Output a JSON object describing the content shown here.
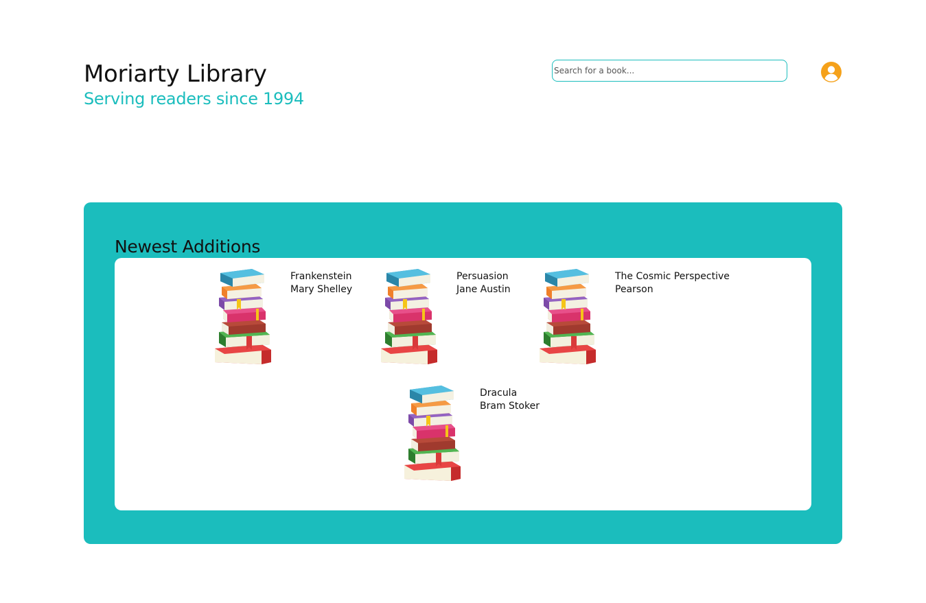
{
  "header": {
    "title": "Moriarty Library",
    "tagline": "Serving readers since 1994"
  },
  "search": {
    "placeholder": "Search for a book..."
  },
  "account": {
    "icon": "user-circle-icon",
    "color": "#f5a11a"
  },
  "colors": {
    "accent": "#1bbdbd",
    "panel_inner": "#ffffff"
  },
  "newest": {
    "heading": "Newest Additions",
    "books": [
      {
        "title": "Frankenstein",
        "author": "Mary Shelley",
        "cover_icon": "book-stack-icon"
      },
      {
        "title": "Persuasion",
        "author": "Jane Austin",
        "cover_icon": "book-stack-icon"
      },
      {
        "title": "The Cosmic Perspective",
        "author": "Pearson",
        "cover_icon": "book-stack-icon"
      },
      {
        "title": "Dracula",
        "author": "Bram Stoker",
        "cover_icon": "book-stack-icon"
      }
    ]
  }
}
